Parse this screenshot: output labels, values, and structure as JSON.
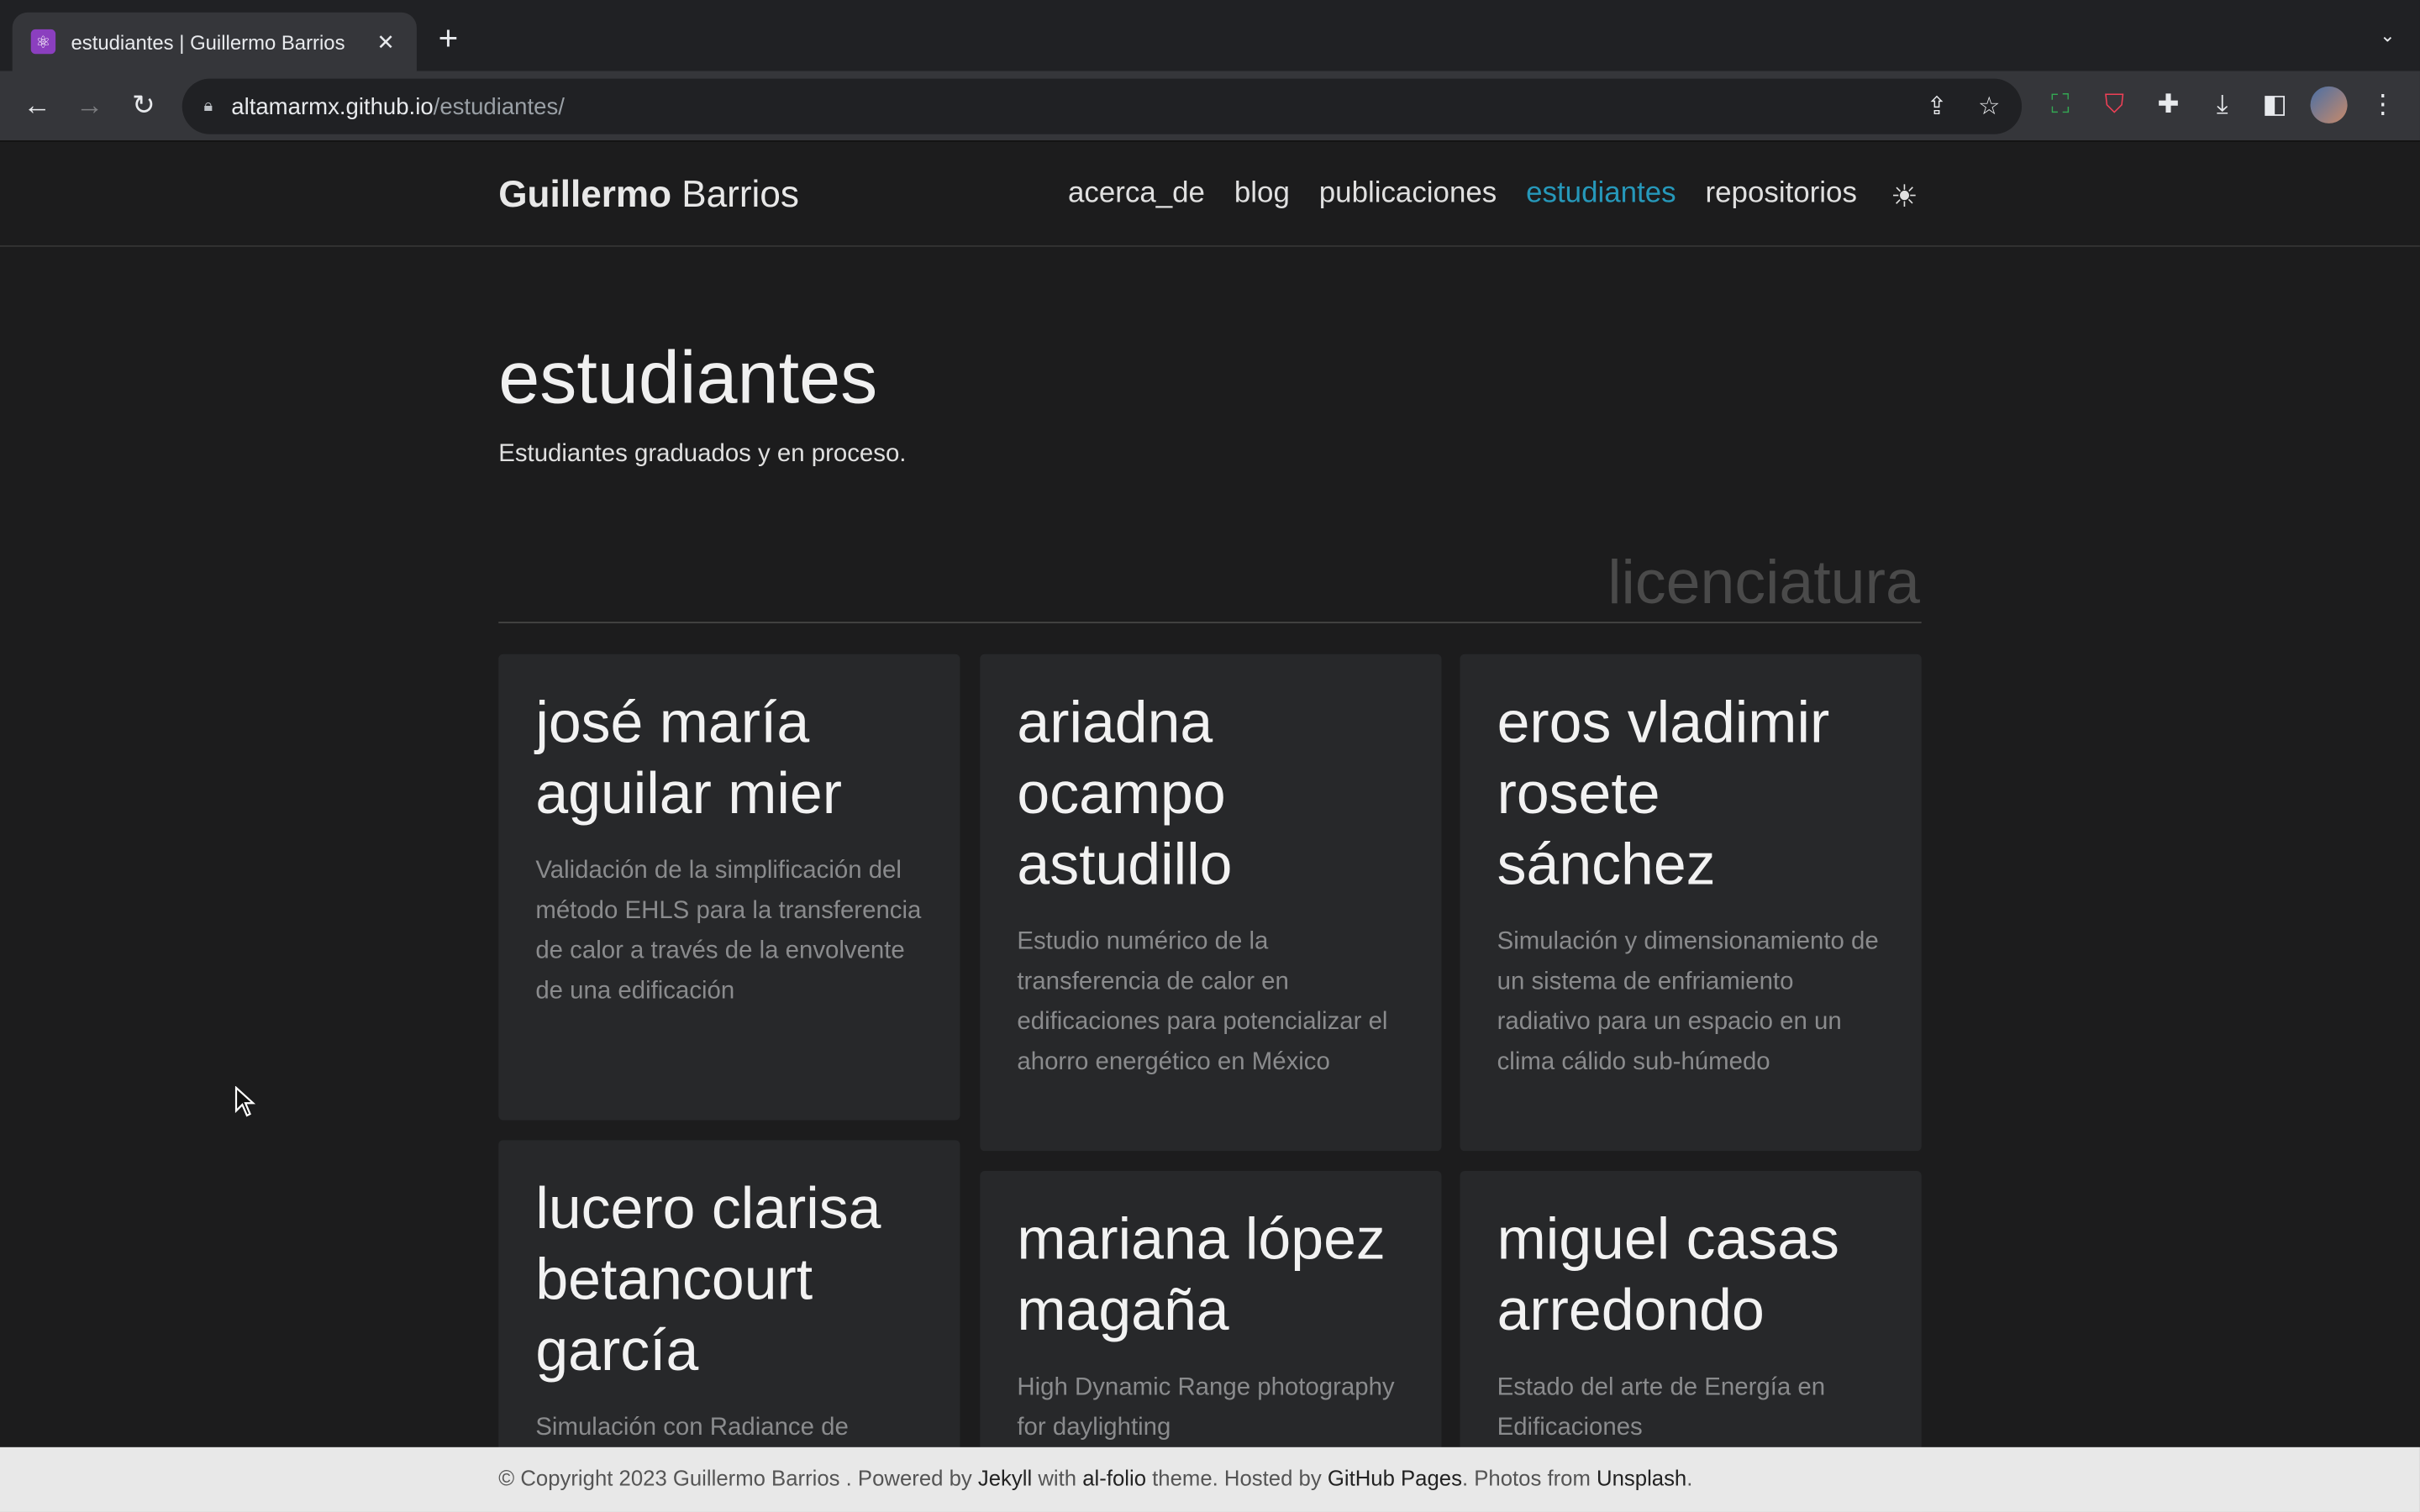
{
  "browser": {
    "tab_title": "estudiantes | Guillermo Barrios",
    "tab_close": "✕",
    "new_tab": "+",
    "tab_menu": "⌄",
    "url_host": "altamarmx.github.io",
    "url_path": "/estudiantes/"
  },
  "site": {
    "brand_first": "Guillermo",
    "brand_last": " Barrios",
    "nav": [
      {
        "label": "acerca_de"
      },
      {
        "label": "blog"
      },
      {
        "label": "publicaciones"
      },
      {
        "label": "estudiantes",
        "active": true
      },
      {
        "label": "repositorios"
      }
    ],
    "theme_icon": "☀"
  },
  "page": {
    "title": "estudiantes",
    "description": "Estudiantes graduados y en proceso.",
    "section": "licenciatura"
  },
  "students": [
    {
      "name": "josé maría aguilar mier",
      "thesis": "Validación de la simplificación del método EHLS para la transferencia de calor a través de la envolvente de una edificación"
    },
    {
      "name": "ariadna ocampo astudillo",
      "thesis": "Estudio numérico de la transferencia de calor en edificaciones para potencializar el ahorro energético en México"
    },
    {
      "name": "eros vladimir rosete sánchez",
      "thesis": "Simulación y dimensionamiento de un sistema de enfriamiento radiativo para un espacio en un clima cálido sub-húmedo"
    },
    {
      "name": "lucero clarisa betancourt garcía",
      "thesis": "Simulación con Radiance de"
    },
    {
      "name": "mariana lópez magaña",
      "thesis": "High Dynamic Range photography for daylighting"
    },
    {
      "name": "miguel casas arredondo",
      "thesis": "Estado del arte de Energía en Edificaciones"
    }
  ],
  "footer": {
    "t1": "© Copyright 2023 Guillermo Barrios . Powered by ",
    "jekyll": "Jekyll",
    "t2": " with ",
    "alfolio": "al-folio",
    "t3": " theme. Hosted by ",
    "ghpages": "GitHub Pages",
    "t4": ". Photos from ",
    "unsplash": "Unsplash",
    "t5": "."
  }
}
